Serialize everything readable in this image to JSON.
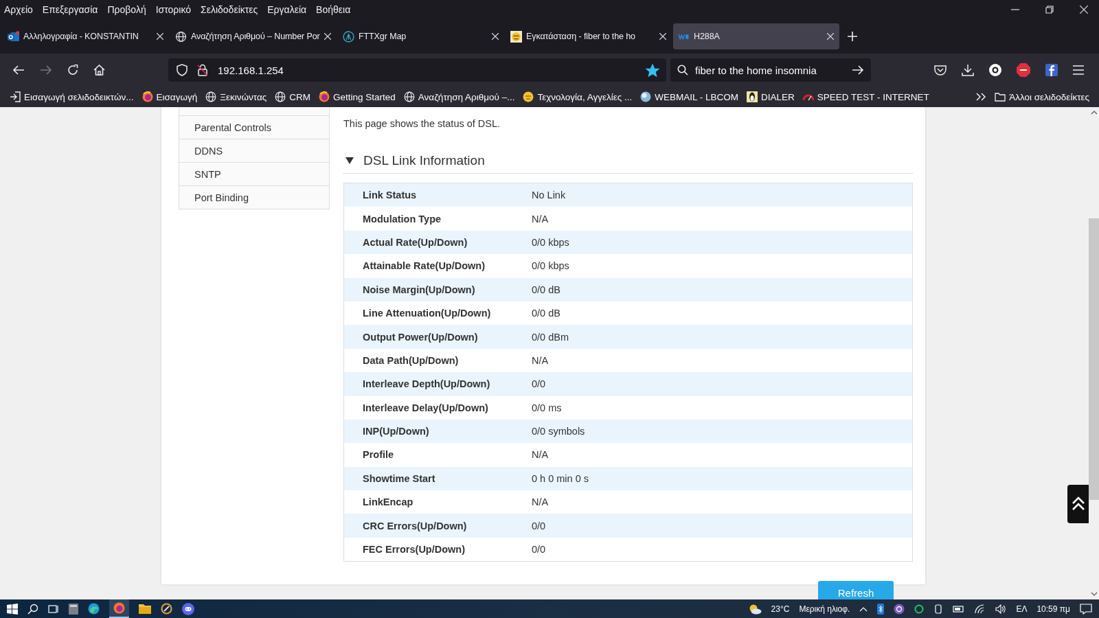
{
  "menu": [
    "Αρχείο",
    "Επεξεργασία",
    "Προβολή",
    "Ιστορικό",
    "Σελιδοδείκτες",
    "Εργαλεία",
    "Βοήθεια"
  ],
  "tabs": [
    {
      "kind": "mail",
      "title": "Αλληλογραφία - KONSTANTIN",
      "selected": false
    },
    {
      "kind": "globe",
      "title": "Αναζήτηση Αριθμού – Number Por",
      "selected": false
    },
    {
      "kind": "map",
      "title": "FTTXgr Map",
      "selected": false
    },
    {
      "kind": "face",
      "title": "Εγκατάσταση - fiber to the ho",
      "selected": false
    },
    {
      "kind": "brand",
      "title": "H288A",
      "selected": true
    }
  ],
  "address": {
    "url": "192.168.1.254",
    "bookmarked": true
  },
  "search": {
    "value": "fiber to the home insomnia"
  },
  "bookmarks": [
    {
      "kind": "import",
      "label": "Εισαγωγή σελιδοδεικτών..."
    },
    {
      "kind": "firefox",
      "label": "Εισαγωγή"
    },
    {
      "kind": "globe",
      "label": "Ξεκινώντας"
    },
    {
      "kind": "globe",
      "label": "CRM"
    },
    {
      "kind": "firefox",
      "label": "Getting Started"
    },
    {
      "kind": "globe",
      "label": "Αναζήτηση Αριθμού –..."
    },
    {
      "kind": "face",
      "label": "Τεχνολογία, Αγγελίες ..."
    },
    {
      "kind": "sphere",
      "label": "WEBMAIL - LBCOM"
    },
    {
      "kind": "penguin",
      "label": "DIALER"
    },
    {
      "kind": "gauge",
      "label": "SPEED TEST - INTERNET"
    }
  ],
  "other_bookmarks": "Άλλοι σελιδοδείκτες",
  "sidebar": {
    "items": [
      "Parental Controls",
      "DDNS",
      "SNTP",
      "Port Binding"
    ]
  },
  "page": {
    "description": "This page shows the status of DSL.",
    "section": {
      "title": "DSL Link Information",
      "expanded": true
    },
    "rows": [
      {
        "label": "Link Status",
        "value": "No Link"
      },
      {
        "label": "Modulation Type",
        "value": "N/A"
      },
      {
        "label": "Actual Rate(Up/Down)",
        "value": "0/0 kbps"
      },
      {
        "label": "Attainable Rate(Up/Down)",
        "value": "0/0 kbps"
      },
      {
        "label": "Noise Margin(Up/Down)",
        "value": "0/0 dB"
      },
      {
        "label": "Line Attenuation(Up/Down)",
        "value": "0/0 dB"
      },
      {
        "label": "Output Power(Up/Down)",
        "value": "0/0 dBm"
      },
      {
        "label": "Data Path(Up/Down)",
        "value": "N/A"
      },
      {
        "label": "Interleave Depth(Up/Down)",
        "value": "0/0"
      },
      {
        "label": "Interleave Delay(Up/Down)",
        "value": "0/0 ms"
      },
      {
        "label": "INP(Up/Down)",
        "value": "0/0 symbols"
      },
      {
        "label": "Profile",
        "value": "N/A"
      },
      {
        "label": "Showtime Start",
        "value": "0 h 0 min 0 s"
      },
      {
        "label": "LinkEncap",
        "value": "N/A"
      },
      {
        "label": "CRC Errors(Up/Down)",
        "value": "0/0"
      },
      {
        "label": "FEC Errors(Up/Down)",
        "value": "0/0"
      }
    ],
    "button": "Refresh"
  },
  "taskbar": {
    "weather": "23°C",
    "forecast": "Μερική ηλιοφ.",
    "language": "ΕΛ",
    "time": "10:59 πμ"
  }
}
